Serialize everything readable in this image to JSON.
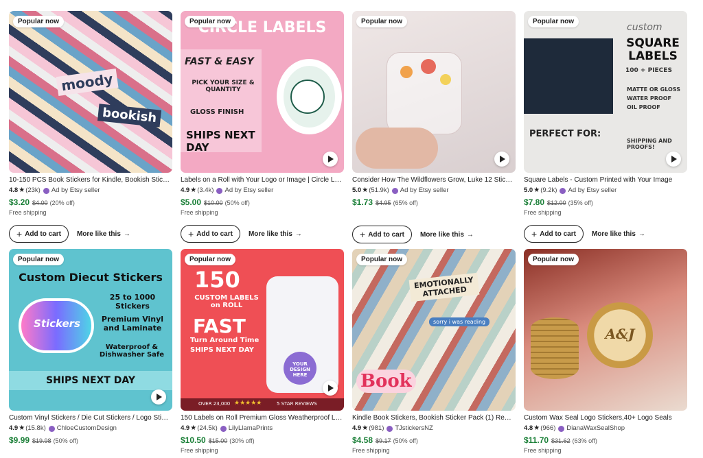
{
  "badge_label": "Popular now",
  "add_to_cart_label": "Add to cart",
  "more_like_this_label": "More like this",
  "products": [
    {
      "title": "10-150 PCS Book Stickers for Kindle, Bookish Stickers",
      "rating": "4.8",
      "reviews": "(23k)",
      "seller": "Ad by Etsy seller",
      "price": "$3.20",
      "orig_price": "$4.00",
      "discount": "(20% off)",
      "shipping": "Free shipping",
      "popular": true,
      "video": false,
      "actions": true,
      "image_text": [
        "moody",
        "bookish"
      ]
    },
    {
      "title": "Labels on a Roll with Your Logo or Image | Circle Labels",
      "rating": "4.9",
      "reviews": "(3.4k)",
      "seller": "Ad by Etsy seller",
      "price": "$5.00",
      "orig_price": "$10.00",
      "discount": "(50% off)",
      "shipping": "Free shipping",
      "popular": true,
      "video": true,
      "actions": true,
      "image_text": [
        "CIRCLE LABELS",
        "FAST & EASY",
        "PICK YOUR SIZE & QUANTITY",
        "GLOSS FINISH",
        "SHIPS NEXT DAY"
      ]
    },
    {
      "title": "Consider How The Wildflowers Grow, Luke 12 Sticker",
      "rating": "5.0",
      "reviews": "(51.9k)",
      "seller": "Ad by Etsy seller",
      "price": "$1.73",
      "orig_price": "$4.95",
      "discount": "(65% off)",
      "shipping": "",
      "popular": true,
      "video": true,
      "actions": true,
      "image_text": []
    },
    {
      "title": "Square Labels - Custom Printed with Your Image",
      "rating": "5.0",
      "reviews": "(9.2k)",
      "seller": "Ad by Etsy seller",
      "price": "$7.80",
      "orig_price": "$12.00",
      "discount": "(35% off)",
      "shipping": "Free shipping",
      "popular": true,
      "video": true,
      "actions": true,
      "image_text": [
        "custom",
        "SQUARE LABELS",
        "100 + PIECES",
        "MATTE OR GLOSS",
        "WATER PROOF",
        "OIL PROOF",
        "PERFECT FOR:",
        "SHIPPING AND PROOFS!"
      ]
    },
    {
      "title": "Custom Vinyl Stickers / Die Cut Stickers / Logo Stickers",
      "rating": "4.9",
      "reviews": "(15.8k)",
      "seller": "ChloeCustomDesign",
      "price": "$9.99",
      "orig_price": "$19.98",
      "discount": "(50% off)",
      "shipping": "",
      "popular": true,
      "video": true,
      "actions": false,
      "image_text": [
        "Custom Diecut Stickers",
        "25 to 1000 Stickers",
        "Premium Vinyl and Laminate",
        "Waterproof & Dishwasher Safe",
        "SHIPS NEXT DAY",
        "Stickers"
      ]
    },
    {
      "title": "150 Labels on Roll Premium Gloss Weatherproof Labels",
      "rating": "4.9",
      "reviews": "(24.5k)",
      "seller": "LilyLlamaPrints",
      "price": "$10.50",
      "orig_price": "$15.00",
      "discount": "(30% off)",
      "shipping": "Free shipping",
      "popular": true,
      "video": true,
      "actions": false,
      "image_text": [
        "150",
        "CUSTOM LABELS on ROLL",
        "FAST",
        "Turn Around Time",
        "SHIPS NEXT DAY",
        "OVER 23,000",
        "5 STAR REVIEWS",
        "YOUR DESIGN HERE"
      ]
    },
    {
      "title": "Kindle Book Stickers, Bookish Sticker Pack (1) Reading",
      "rating": "4.9",
      "reviews": "(981)",
      "seller": "TJstickersNZ",
      "price": "$4.58",
      "orig_price": "$9.17",
      "discount": "(50% off)",
      "shipping": "Free shipping",
      "popular": true,
      "video": false,
      "actions": false,
      "image_text": [
        "EMOTIONALLY ATTACHED",
        "Book",
        "sorry i was reading"
      ]
    },
    {
      "title": "Custom Wax Seal Logo Stickers,40+ Logo Seals",
      "rating": "4.8",
      "reviews": "(966)",
      "seller": "DianaWaxSealShop",
      "price": "$11.70",
      "orig_price": "$31.62",
      "discount": "(63% off)",
      "shipping": "Free shipping",
      "popular": true,
      "video": false,
      "actions": false,
      "image_text": [
        "A&J"
      ]
    }
  ]
}
